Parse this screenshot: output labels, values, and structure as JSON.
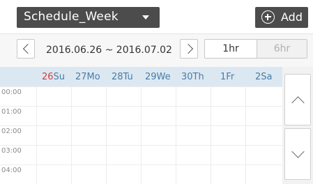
{
  "header": {
    "view_label": "Schedule_Week",
    "add_label": "Add"
  },
  "nav": {
    "date_range": "2016.06.26 ~ 2016.07.02",
    "zoom_options": [
      "1hr",
      "6hr"
    ],
    "zoom_selected": "1hr"
  },
  "week": {
    "days": [
      {
        "num": "26",
        "name": "Su"
      },
      {
        "num": "27",
        "name": "Mo"
      },
      {
        "num": "28",
        "name": "Tu"
      },
      {
        "num": "29",
        "name": "We"
      },
      {
        "num": "30",
        "name": "Th"
      },
      {
        "num": "1",
        "name": "Fr"
      },
      {
        "num": "2",
        "name": "Sa"
      }
    ]
  },
  "times": [
    "00:00",
    "01:00",
    "02:00",
    "03:00",
    "04:00"
  ],
  "colors": {
    "dark_button": "#4c4c4c",
    "header_row": "#dce8f1",
    "sunday": "#d63b3b",
    "weekday": "#4a7ba6"
  },
  "icons": [
    "chevron-down-icon",
    "add-circle-icon",
    "chevron-left-icon",
    "chevron-right-icon",
    "chevron-up-icon",
    "chevron-down-scroll-icon"
  ]
}
